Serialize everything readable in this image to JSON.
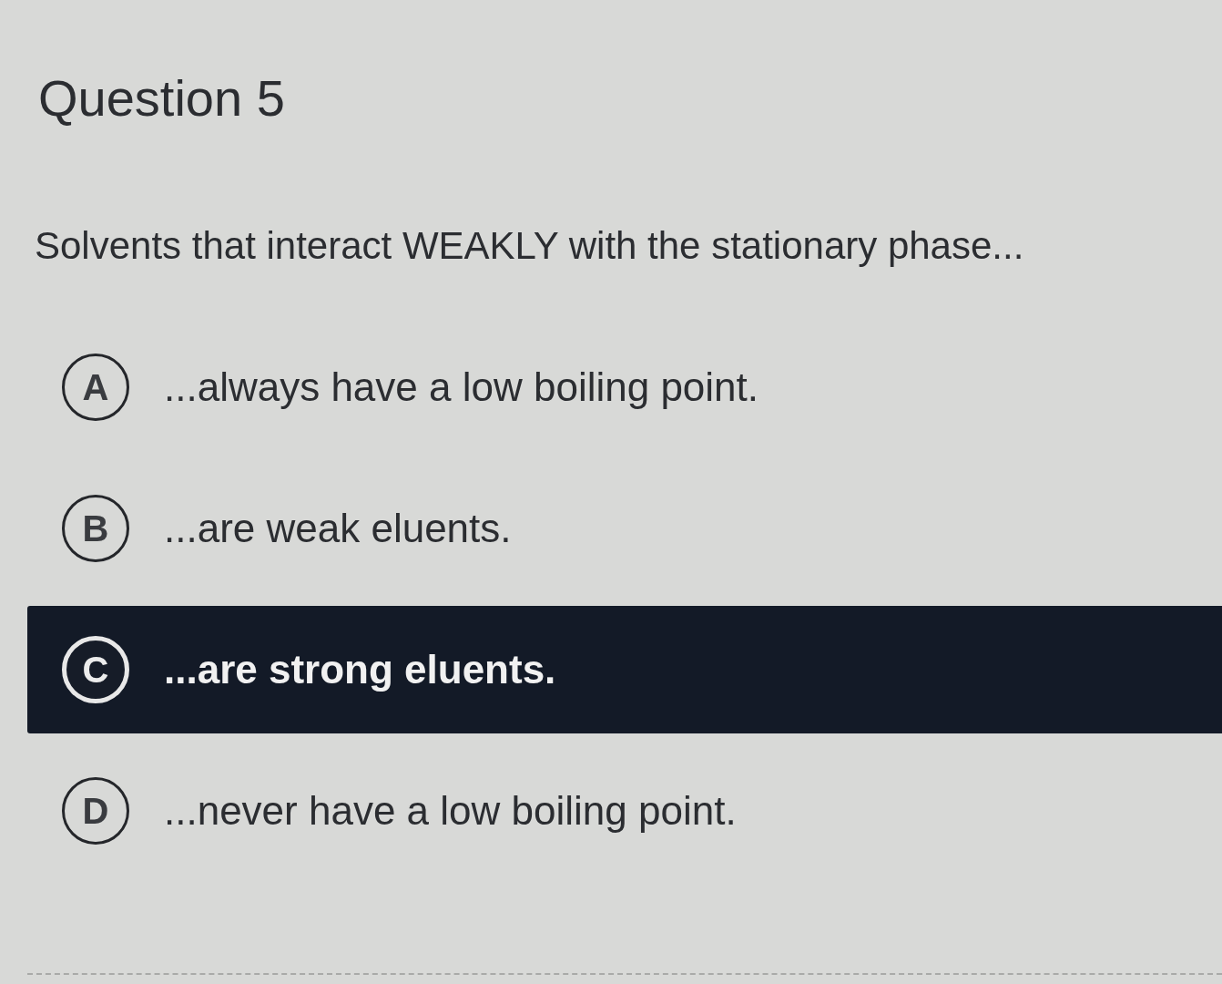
{
  "title": "Question 5",
  "prompt": "Solvents that interact WEAKLY with the stationary phase...",
  "options": [
    {
      "letter": "A",
      "text": "...always have a low boiling point.",
      "selected": false
    },
    {
      "letter": "B",
      "text": "...are weak eluents.",
      "selected": false
    },
    {
      "letter": "C",
      "text": "...are strong eluents.",
      "selected": true
    },
    {
      "letter": "D",
      "text": "...never have a low boiling point.",
      "selected": false
    }
  ]
}
